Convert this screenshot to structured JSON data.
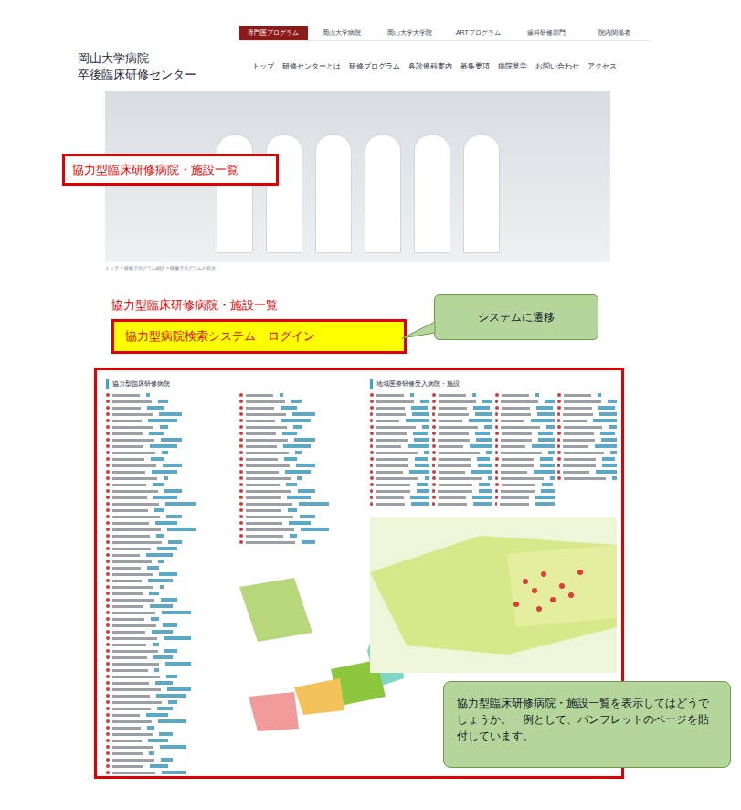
{
  "top_bar": [
    {
      "label": "専門医プログラム",
      "selected": true
    },
    {
      "label": "岡山大学病院",
      "selected": false
    },
    {
      "label": "岡山大学大学院",
      "selected": false
    },
    {
      "label": "ARTプログラム",
      "selected": false
    },
    {
      "label": "歯科研修部門",
      "selected": false
    },
    {
      "label": "院内関係者",
      "selected": false
    }
  ],
  "header": {
    "title_line1": "岡山大学病院",
    "title_line2": "卒後臨床研修センター"
  },
  "nav": [
    "トップ",
    "研修センターとは",
    "研修プログラム",
    "各診療科案内",
    "募集要項",
    "病院見学",
    "お問い合わせ",
    "アクセス"
  ],
  "hero_label": "協力型臨床研修病院・施設一覧",
  "breadcrumb": "トップ > 研修プログラム紹介 > 研修プログラムの目次",
  "heading": "協力型臨床研修病院・施設一覧",
  "login_button": "協力型病院検索システム　ログイン",
  "callout_top": "システムに遷移",
  "callout_bottom": "協力型臨床研修病院・施設一覧を表示してはどうでしょうか。一例として、パンフレットのページを貼付しています。",
  "pamphlet": {
    "left_title": "協力型臨床研修病院",
    "right_title": "地域医療研修受入病院・施設"
  }
}
